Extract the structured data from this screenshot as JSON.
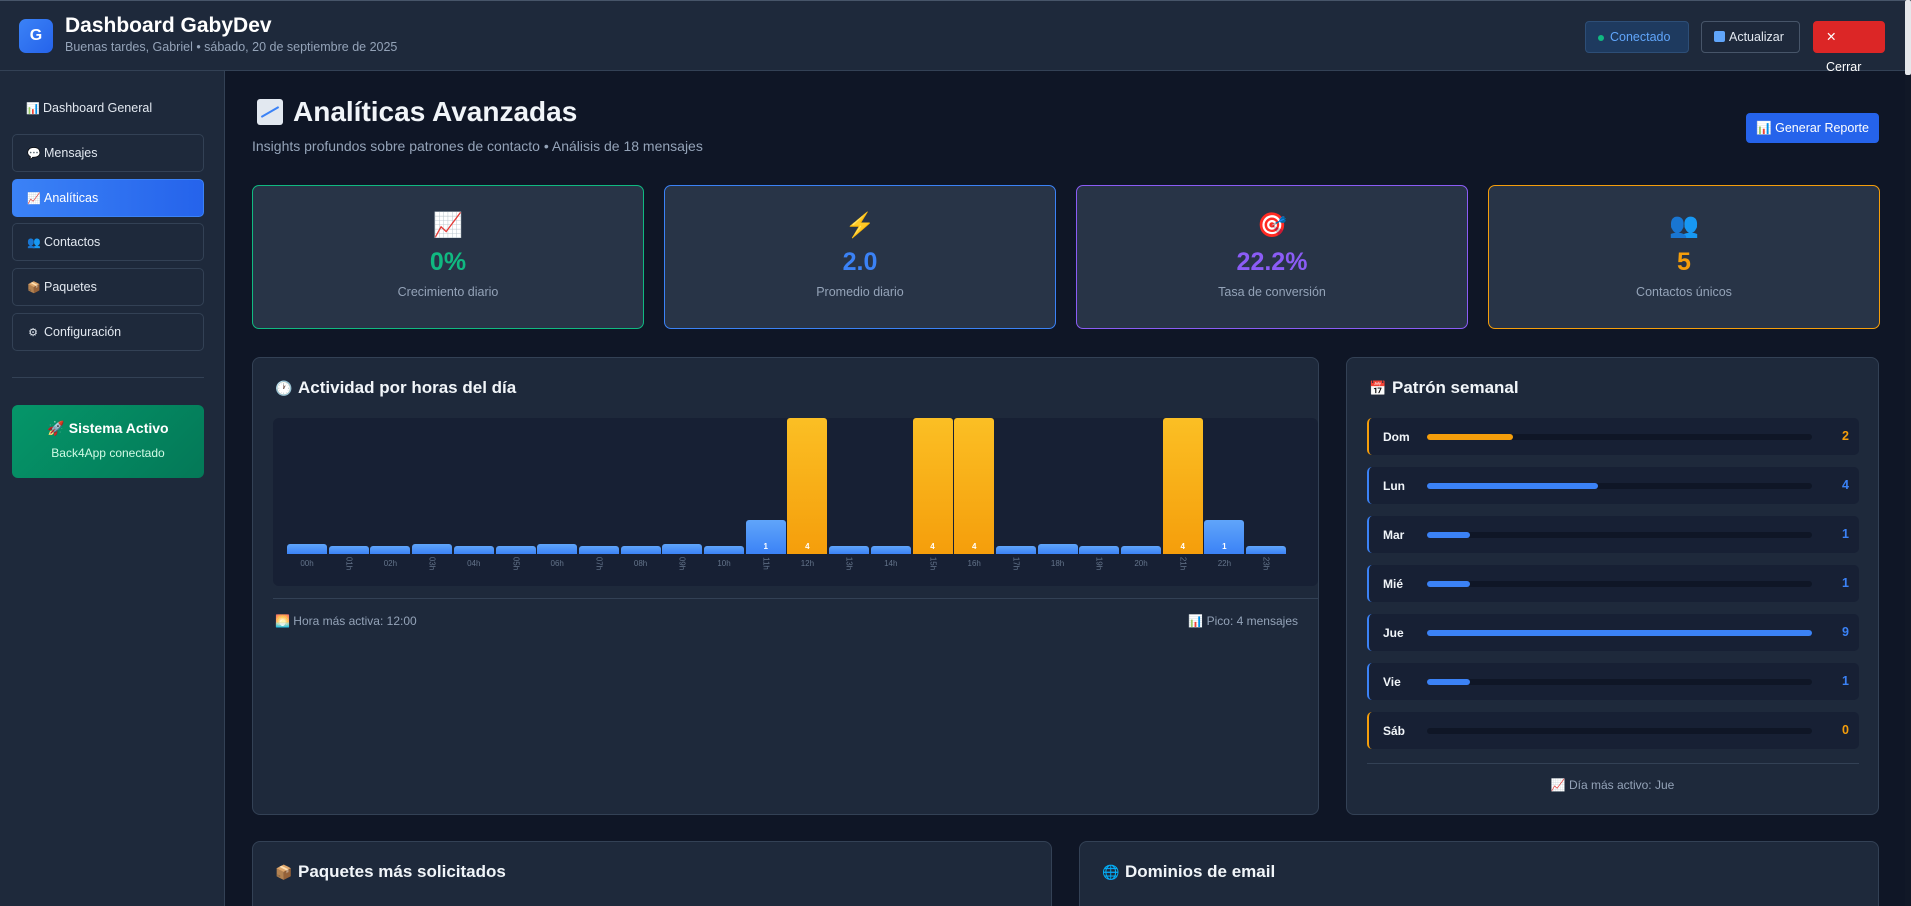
{
  "header": {
    "logo_letter": "G",
    "title": "Dashboard GabyDev",
    "greeting": "Buenas tardes, Gabriel • sábado, 20 de septiembre de 2025",
    "connected_label": "Conectado",
    "refresh_label": "Actualizar",
    "close_label": "✕ Cerrar"
  },
  "sidebar": {
    "items": [
      {
        "icon": "📊",
        "label": "Dashboard General"
      },
      {
        "icon": "💬",
        "label": "Mensajes"
      },
      {
        "icon": "📈",
        "label": "Analíticas"
      },
      {
        "icon": "👥",
        "label": "Contactos"
      },
      {
        "icon": "📦",
        "label": "Paquetes"
      },
      {
        "icon": "⚙",
        "label": "Configuración"
      }
    ],
    "active_index": 2,
    "system": {
      "title": "🚀 Sistema Activo",
      "subtitle": "Back4App conectado"
    }
  },
  "main": {
    "title": "Analíticas Avanzadas",
    "subtitle": "Insights profundos sobre patrones de contacto • Análisis de 18 mensajes",
    "report_button": "📊 Generar Reporte"
  },
  "stats": [
    {
      "icon": "📈",
      "value": "0%",
      "label": "Crecimiento diario",
      "color": "#10b981"
    },
    {
      "icon": "⚡",
      "value": "2.0",
      "label": "Promedio diario",
      "color": "#3b82f6"
    },
    {
      "icon": "🎯",
      "value": "22.2%",
      "label": "Tasa de conversión",
      "color": "#8b5cf6"
    },
    {
      "icon": "👥",
      "value": "5",
      "label": "Contactos únicos",
      "color": "#f59e0b"
    }
  ],
  "hourly": {
    "title": "Actividad por horas del día",
    "labels": [
      "00h",
      "01h",
      "02h",
      "03h",
      "04h",
      "05h",
      "06h",
      "07h",
      "08h",
      "09h",
      "10h",
      "11h",
      "12h",
      "13h",
      "14h",
      "15h",
      "16h",
      "17h",
      "18h",
      "19h",
      "20h",
      "21h",
      "22h",
      "23h"
    ],
    "values": [
      0,
      0,
      0,
      0,
      0,
      0,
      0,
      0,
      0,
      0,
      0,
      1,
      4,
      0,
      0,
      4,
      4,
      0,
      0,
      0,
      0,
      4,
      1,
      0
    ],
    "max": 4,
    "most_active": "🌅 Hora más activa: 12:00",
    "peak": "📊 Pico: 4 mensajes"
  },
  "weekly": {
    "title": "Patrón semanal",
    "days": [
      {
        "day": "Dom",
        "count": 2,
        "highlight": true
      },
      {
        "day": "Lun",
        "count": 4,
        "highlight": false
      },
      {
        "day": "Mar",
        "count": 1,
        "highlight": false
      },
      {
        "day": "Mié",
        "count": 1,
        "highlight": false
      },
      {
        "day": "Jue",
        "count": 9,
        "highlight": false
      },
      {
        "day": "Vie",
        "count": 1,
        "highlight": false
      },
      {
        "day": "Sáb",
        "count": 0,
        "highlight": true
      }
    ],
    "max": 9,
    "most_active": "📈 Día más activo: Jue"
  },
  "bottom_panels": {
    "packages_title": "Paquetes más solicitados",
    "domains_title": "Dominios de email"
  },
  "colors": {
    "accent": "#3b82f6",
    "peak": "#f59e0b",
    "success": "#10b981",
    "danger": "#dc2626"
  }
}
